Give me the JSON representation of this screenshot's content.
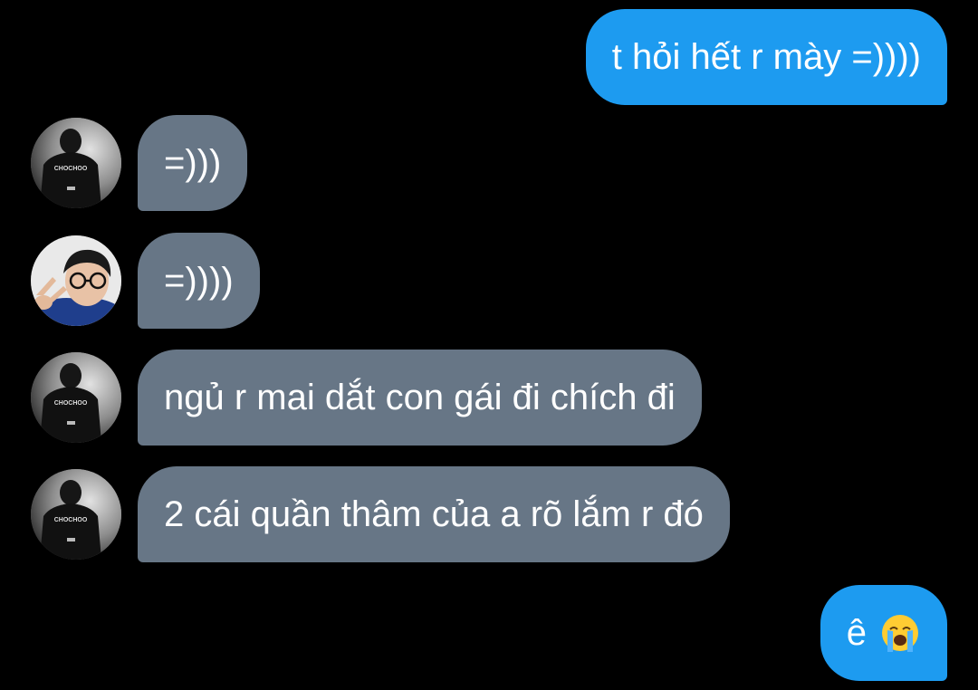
{
  "messages": [
    {
      "direction": "out",
      "text": "t hỏi hết r mày =))))"
    },
    {
      "direction": "in",
      "avatar": "avatar-black-jersey",
      "text": "=)))"
    },
    {
      "direction": "in",
      "avatar": "avatar-glasses-peace-sign",
      "text": "=))))"
    },
    {
      "direction": "in",
      "avatar": "avatar-black-jersey",
      "text": "ngủ r mai dắt con gái đi chích đi"
    },
    {
      "direction": "in",
      "avatar": "avatar-black-jersey",
      "text": "2 cái quần thâm của a rõ lắm r đó"
    },
    {
      "direction": "out",
      "text": "ê",
      "emoji": "loudly-crying-face-icon"
    }
  ],
  "jersey_logo_text": "CHOCHOO",
  "colors": {
    "background": "#000000",
    "outgoing_bubble": "#1d9bf0",
    "incoming_bubble": "#677686",
    "text": "#ffffff"
  }
}
